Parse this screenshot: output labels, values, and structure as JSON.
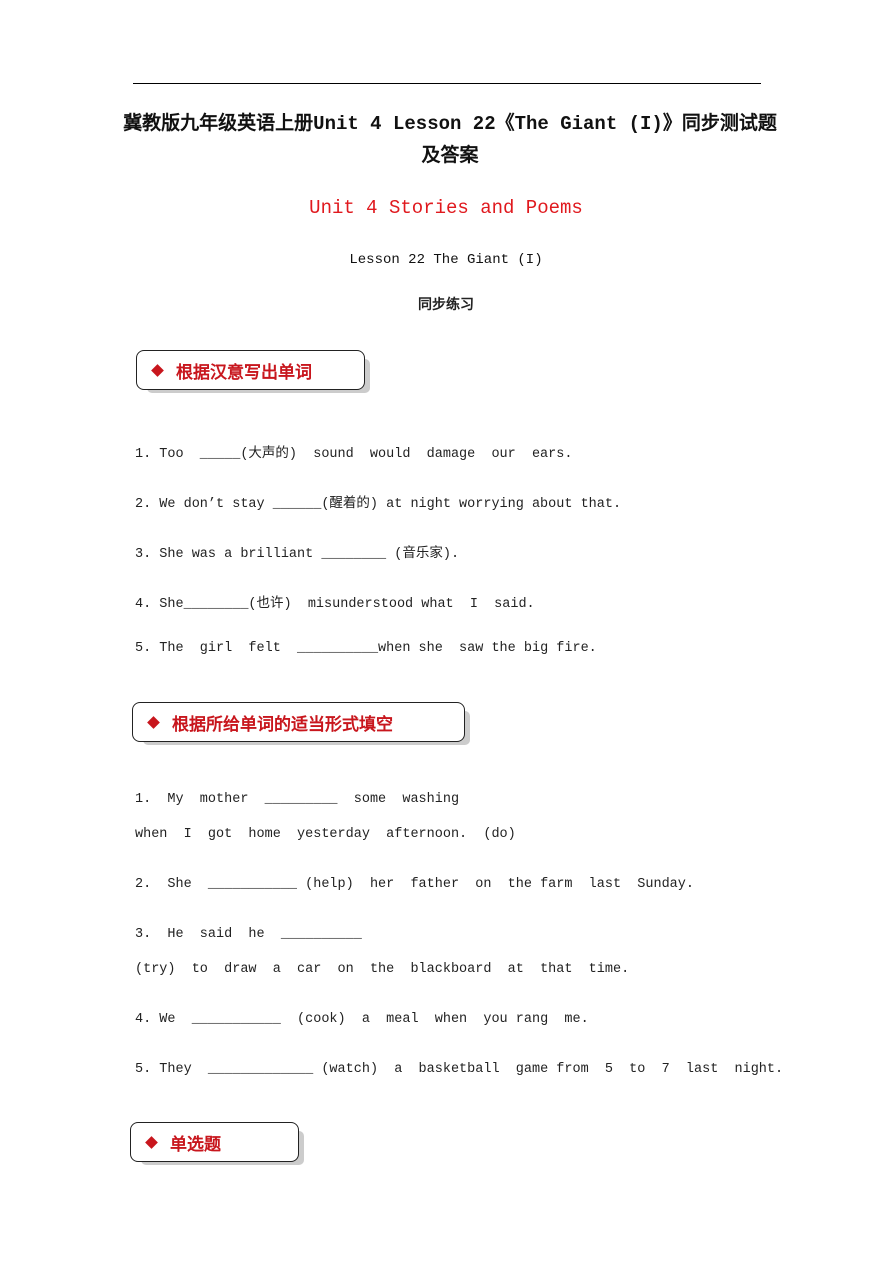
{
  "title": "冀教版九年级英语上册Unit 4 Lesson 22《The Giant (I)》同步测试题及答案",
  "unit_heading": "Unit 4 Stories and Poems",
  "lesson_heading": "Lesson 22 The Giant (I)",
  "practice_label": "同步练习",
  "sections": [
    {
      "heading": "根据汉意写出单词",
      "items": [
        "1. Too  _____(大声的)  sound  would  damage  our  ears.",
        "2. We don’t stay ______(醒着的) at night worrying about that.",
        "3. She was a brilliant ________ (音乐家).",
        "4. She________(也许)  misunderstood what  I  said.",
        "5. The  girl  felt  __________when she  saw the big fire."
      ]
    },
    {
      "heading": "根据所给单词的适当形式填空",
      "items": [
        "1.  My  mother  _________  some  washing",
        "when  I  got  home  yesterday  afternoon.  (do)",
        "2.  She  ___________ (help)  her  father  on  the farm  last  Sunday.",
        "3.  He  said  he  __________",
        "(try)  to  draw  a  car  on  the  blackboard  at  that  time.",
        "4. We  ___________  (cook)  a  meal  when  you rang  me.",
        "5. They  _____________ (watch)  a  basketball  game from  5  to  7  last  night."
      ]
    },
    {
      "heading": "单选题"
    }
  ],
  "colors": {
    "accent": "#c8161d",
    "unit_heading": "#e0191e"
  }
}
